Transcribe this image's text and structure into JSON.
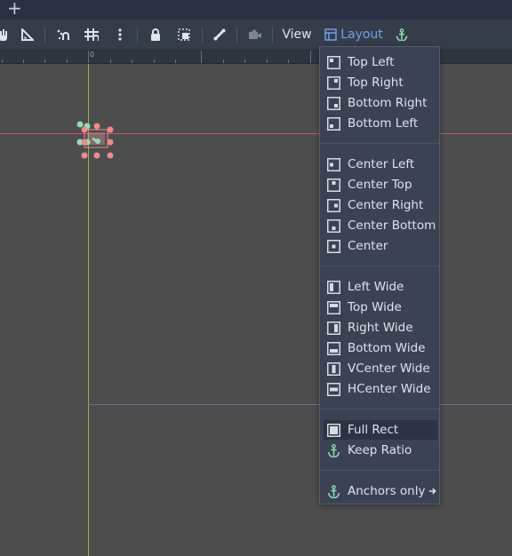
{
  "toolbar": {
    "view_label": "View",
    "layout_label": "Layout"
  },
  "ruler": {
    "origin_label": "0"
  },
  "layout_menu": {
    "anchor_presets": [
      {
        "label": "Top Left",
        "icon": "anchor-top-left-icon"
      },
      {
        "label": "Top Right",
        "icon": "anchor-top-right-icon"
      },
      {
        "label": "Bottom Right",
        "icon": "anchor-bottom-right-icon"
      },
      {
        "label": "Bottom Left",
        "icon": "anchor-bottom-left-icon"
      }
    ],
    "center_presets": [
      {
        "label": "Center Left",
        "icon": "anchor-center-left-icon"
      },
      {
        "label": "Center Top",
        "icon": "anchor-center-top-icon"
      },
      {
        "label": "Center Right",
        "icon": "anchor-center-right-icon"
      },
      {
        "label": "Center Bottom",
        "icon": "anchor-center-bottom-icon"
      },
      {
        "label": "Center",
        "icon": "anchor-center-icon"
      }
    ],
    "wide_presets": [
      {
        "label": "Left Wide",
        "icon": "anchor-left-wide-icon"
      },
      {
        "label": "Top Wide",
        "icon": "anchor-top-wide-icon"
      },
      {
        "label": "Right Wide",
        "icon": "anchor-right-wide-icon"
      },
      {
        "label": "Bottom Wide",
        "icon": "anchor-bottom-wide-icon"
      },
      {
        "label": "VCenter Wide",
        "icon": "anchor-vcenter-wide-icon"
      },
      {
        "label": "HCenter Wide",
        "icon": "anchor-hcenter-wide-icon"
      }
    ],
    "full_rect": {
      "label": "Full Rect",
      "icon": "full-rect-icon"
    },
    "keep_ratio": {
      "label": "Keep Ratio",
      "icon": "anchor-icon"
    },
    "anchors_only": {
      "label": "Anchors only",
      "icon": "anchor-icon",
      "submenu_icon": "arrow-right-icon"
    }
  },
  "colors": {
    "accent": "#6ea0e8",
    "anchor_green": "#8ee0b0",
    "handle_red": "#f08a8a",
    "guide_green": "#8fb83a",
    "guide_red": "#c4546c"
  }
}
